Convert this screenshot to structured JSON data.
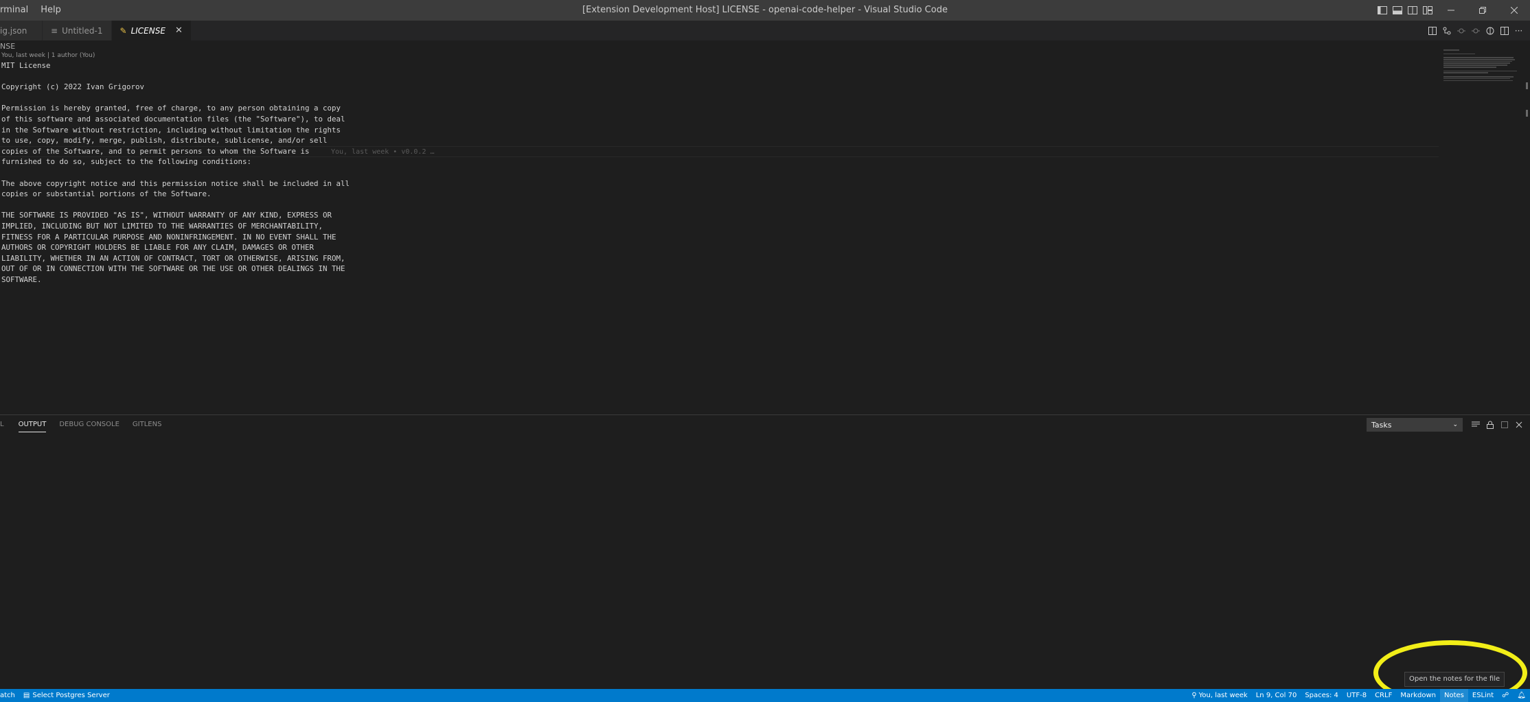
{
  "menu": [
    "rminal",
    "Help"
  ],
  "window_title": "[Extension Development Host] LICENSE - openai-code-helper - Visual Studio Code",
  "tabs": [
    {
      "label": "ig.json",
      "icon": "json-file-icon"
    },
    {
      "label": "Untitled-1",
      "icon": "text-file-icon"
    },
    {
      "label": "LICENSE",
      "icon": "license-file-icon",
      "active": true
    }
  ],
  "breadcrumb": "NSE",
  "codelens": "You, last week | 1 author (You)",
  "code_lines": [
    "MIT License",
    "",
    "Copyright (c) 2022 Ivan Grigorov",
    "",
    "Permission is hereby granted, free of charge, to any person obtaining a copy",
    "of this software and associated documentation files (the \"Software\"), to deal",
    "in the Software without restriction, including without limitation the rights",
    "to use, copy, modify, merge, publish, distribute, sublicense, and/or sell",
    "copies of the Software, and to permit persons to whom the Software is",
    "furnished to do so, subject to the following conditions:",
    "",
    "The above copyright notice and this permission notice shall be included in all",
    "copies or substantial portions of the Software.",
    "",
    "THE SOFTWARE IS PROVIDED \"AS IS\", WITHOUT WARRANTY OF ANY KIND, EXPRESS OR",
    "IMPLIED, INCLUDING BUT NOT LIMITED TO THE WARRANTIES OF MERCHANTABILITY,",
    "FITNESS FOR A PARTICULAR PURPOSE AND NONINFRINGEMENT. IN NO EVENT SHALL THE",
    "AUTHORS OR COPYRIGHT HOLDERS BE LIABLE FOR ANY CLAIM, DAMAGES OR OTHER",
    "LIABILITY, WHETHER IN AN ACTION OF CONTRACT, TORT OR OTHERWISE, ARISING FROM,",
    "OUT OF OR IN CONNECTION WITH THE SOFTWARE OR THE USE OR OTHER DEALINGS IN THE",
    "SOFTWARE."
  ],
  "inline_blame": "You, last week • v0.0.2 …",
  "panel": {
    "tabs": [
      "L",
      "OUTPUT",
      "DEBUG CONSOLE",
      "GITLENS"
    ],
    "active_tab": "OUTPUT",
    "task_select": "Tasks"
  },
  "tooltip": "Open the notes for the file",
  "statusbar": {
    "left": [
      "atch",
      "Select Postgres Server"
    ],
    "right": [
      "You, last week",
      "Ln 9, Col 70",
      "Spaces: 4",
      "UTF-8",
      "CRLF",
      "Markdown",
      "Notes",
      "ESLint"
    ]
  },
  "colors": {
    "titlebar": "#3c3c3c",
    "editor_bg": "#1e1e1e",
    "statusbar": "#007acc",
    "highlight_ring": "#f2ee18"
  }
}
